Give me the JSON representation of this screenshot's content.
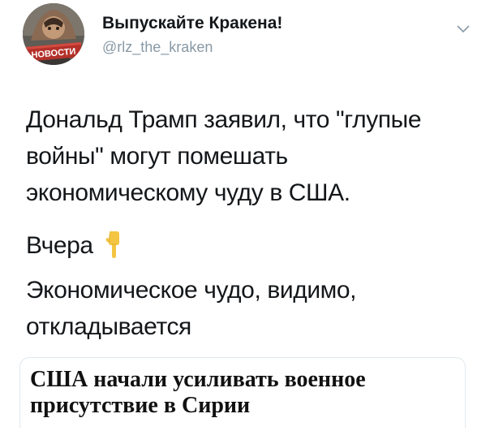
{
  "tweet": {
    "author": {
      "display_name": "Выпускайте Кракена!",
      "handle": "@rlz_the_kraken",
      "avatar_badge": "НОВОСТИ",
      "avatar_icon": "news-avatar-icon"
    },
    "menu_icon": "chevron-down-icon",
    "text": {
      "paragraph1": {
        "line1": "Дональд Трамп заявил, что \"глупые",
        "line2": "войны\" могут помешать",
        "line3": "экономическому чуду в США."
      },
      "paragraph2": {
        "line1": "Вчера",
        "emoji": "backhand-index-pointing-down"
      },
      "paragraph3": {
        "line1": "Экономическое чудо, видимо,",
        "line2": "откладывается"
      }
    },
    "quoted_card": {
      "headline_line1": "США начали усиливать военное",
      "headline_line2": "присутствие в Сирии"
    }
  },
  "colors": {
    "text": "#14171a",
    "muted": "#8899a6",
    "border": "#e1e8ed",
    "badge": "#b3312a"
  }
}
